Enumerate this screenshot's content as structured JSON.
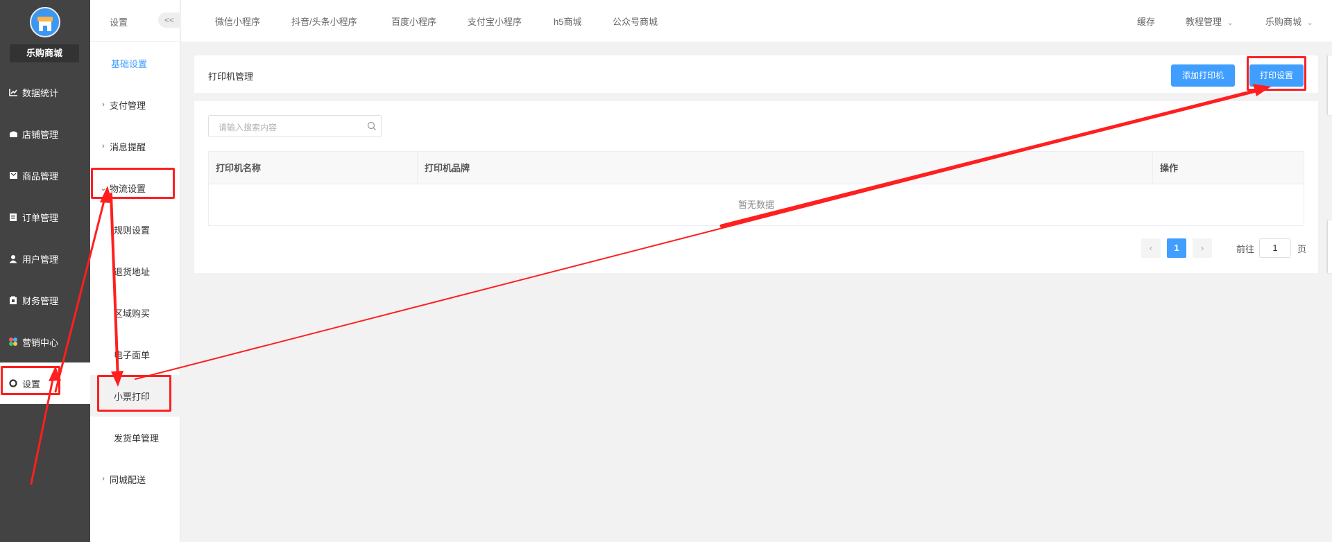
{
  "sidebar": {
    "shop_name": "乐购商城",
    "items": [
      {
        "label": "数据统计",
        "icon": "chart-icon"
      },
      {
        "label": "店铺管理",
        "icon": "store-icon"
      },
      {
        "label": "商品管理",
        "icon": "goods-icon"
      },
      {
        "label": "订单管理",
        "icon": "order-icon"
      },
      {
        "label": "用户管理",
        "icon": "user-icon"
      },
      {
        "label": "财务管理",
        "icon": "finance-icon"
      },
      {
        "label": "营销中心",
        "icon": "marketing-icon"
      },
      {
        "label": "设置",
        "icon": "settings-icon",
        "active": true
      }
    ]
  },
  "submenu": {
    "title": "设置",
    "collapse_label": "<<",
    "items": [
      {
        "label": "基础设置"
      },
      {
        "label": "支付管理"
      },
      {
        "label": "消息提醒"
      },
      {
        "label": "物流设置",
        "expanded": true
      },
      {
        "label": "规则设置"
      },
      {
        "label": "退货地址"
      },
      {
        "label": "区域购买"
      },
      {
        "label": "电子面单"
      },
      {
        "label": "小票打印",
        "active": true
      },
      {
        "label": "发货单管理"
      },
      {
        "label": "同城配送"
      }
    ]
  },
  "topbar": {
    "tabs": [
      "微信小程序",
      "抖音/头条小程序",
      "百度小程序",
      "支付宝小程序",
      "h5商城",
      "公众号商城"
    ],
    "cache": "缓存",
    "tutorial": "教程管理",
    "shop": "乐购商城"
  },
  "page": {
    "title": "打印机管理",
    "add_printer": "添加打印机",
    "print_settings": "打印设置",
    "search_placeholder": "请输入搜索内容",
    "columns": [
      "打印机名称",
      "打印机品牌",
      "操作"
    ],
    "empty_text": "暂无数据",
    "pagination": {
      "prev": "‹",
      "current": "1",
      "next": "›",
      "goto_label": "前往",
      "goto_value": "1",
      "page_suffix": "页"
    }
  },
  "colors": {
    "accent": "#409eff",
    "sidebar": "#434343",
    "annotation": "#ff1f1f"
  }
}
